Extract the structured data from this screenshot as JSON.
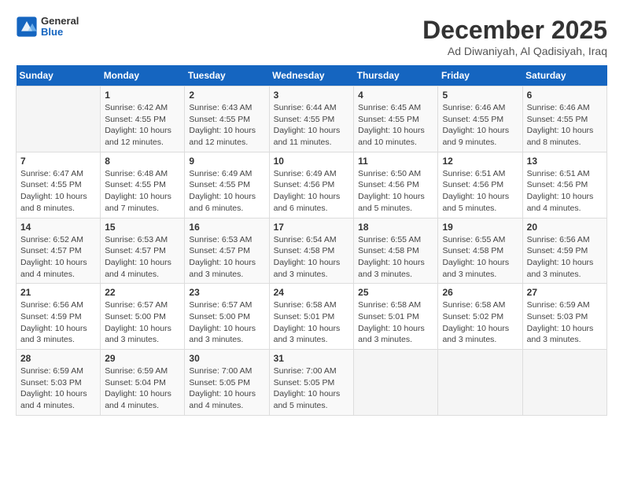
{
  "logo": {
    "text_general": "General",
    "text_blue": "Blue"
  },
  "header": {
    "month": "December 2025",
    "location": "Ad Diwaniyah, Al Qadisiyah, Iraq"
  },
  "weekdays": [
    "Sunday",
    "Monday",
    "Tuesday",
    "Wednesday",
    "Thursday",
    "Friday",
    "Saturday"
  ],
  "weeks": [
    [
      {
        "day": "",
        "info": ""
      },
      {
        "day": "1",
        "info": "Sunrise: 6:42 AM\nSunset: 4:55 PM\nDaylight: 10 hours\nand 12 minutes."
      },
      {
        "day": "2",
        "info": "Sunrise: 6:43 AM\nSunset: 4:55 PM\nDaylight: 10 hours\nand 12 minutes."
      },
      {
        "day": "3",
        "info": "Sunrise: 6:44 AM\nSunset: 4:55 PM\nDaylight: 10 hours\nand 11 minutes."
      },
      {
        "day": "4",
        "info": "Sunrise: 6:45 AM\nSunset: 4:55 PM\nDaylight: 10 hours\nand 10 minutes."
      },
      {
        "day": "5",
        "info": "Sunrise: 6:46 AM\nSunset: 4:55 PM\nDaylight: 10 hours\nand 9 minutes."
      },
      {
        "day": "6",
        "info": "Sunrise: 6:46 AM\nSunset: 4:55 PM\nDaylight: 10 hours\nand 8 minutes."
      }
    ],
    [
      {
        "day": "7",
        "info": "Sunrise: 6:47 AM\nSunset: 4:55 PM\nDaylight: 10 hours\nand 8 minutes."
      },
      {
        "day": "8",
        "info": "Sunrise: 6:48 AM\nSunset: 4:55 PM\nDaylight: 10 hours\nand 7 minutes."
      },
      {
        "day": "9",
        "info": "Sunrise: 6:49 AM\nSunset: 4:55 PM\nDaylight: 10 hours\nand 6 minutes."
      },
      {
        "day": "10",
        "info": "Sunrise: 6:49 AM\nSunset: 4:56 PM\nDaylight: 10 hours\nand 6 minutes."
      },
      {
        "day": "11",
        "info": "Sunrise: 6:50 AM\nSunset: 4:56 PM\nDaylight: 10 hours\nand 5 minutes."
      },
      {
        "day": "12",
        "info": "Sunrise: 6:51 AM\nSunset: 4:56 PM\nDaylight: 10 hours\nand 5 minutes."
      },
      {
        "day": "13",
        "info": "Sunrise: 6:51 AM\nSunset: 4:56 PM\nDaylight: 10 hours\nand 4 minutes."
      }
    ],
    [
      {
        "day": "14",
        "info": "Sunrise: 6:52 AM\nSunset: 4:57 PM\nDaylight: 10 hours\nand 4 minutes."
      },
      {
        "day": "15",
        "info": "Sunrise: 6:53 AM\nSunset: 4:57 PM\nDaylight: 10 hours\nand 4 minutes."
      },
      {
        "day": "16",
        "info": "Sunrise: 6:53 AM\nSunset: 4:57 PM\nDaylight: 10 hours\nand 3 minutes."
      },
      {
        "day": "17",
        "info": "Sunrise: 6:54 AM\nSunset: 4:58 PM\nDaylight: 10 hours\nand 3 minutes."
      },
      {
        "day": "18",
        "info": "Sunrise: 6:55 AM\nSunset: 4:58 PM\nDaylight: 10 hours\nand 3 minutes."
      },
      {
        "day": "19",
        "info": "Sunrise: 6:55 AM\nSunset: 4:58 PM\nDaylight: 10 hours\nand 3 minutes."
      },
      {
        "day": "20",
        "info": "Sunrise: 6:56 AM\nSunset: 4:59 PM\nDaylight: 10 hours\nand 3 minutes."
      }
    ],
    [
      {
        "day": "21",
        "info": "Sunrise: 6:56 AM\nSunset: 4:59 PM\nDaylight: 10 hours\nand 3 minutes."
      },
      {
        "day": "22",
        "info": "Sunrise: 6:57 AM\nSunset: 5:00 PM\nDaylight: 10 hours\nand 3 minutes."
      },
      {
        "day": "23",
        "info": "Sunrise: 6:57 AM\nSunset: 5:00 PM\nDaylight: 10 hours\nand 3 minutes."
      },
      {
        "day": "24",
        "info": "Sunrise: 6:58 AM\nSunset: 5:01 PM\nDaylight: 10 hours\nand 3 minutes."
      },
      {
        "day": "25",
        "info": "Sunrise: 6:58 AM\nSunset: 5:01 PM\nDaylight: 10 hours\nand 3 minutes."
      },
      {
        "day": "26",
        "info": "Sunrise: 6:58 AM\nSunset: 5:02 PM\nDaylight: 10 hours\nand 3 minutes."
      },
      {
        "day": "27",
        "info": "Sunrise: 6:59 AM\nSunset: 5:03 PM\nDaylight: 10 hours\nand 3 minutes."
      }
    ],
    [
      {
        "day": "28",
        "info": "Sunrise: 6:59 AM\nSunset: 5:03 PM\nDaylight: 10 hours\nand 4 minutes."
      },
      {
        "day": "29",
        "info": "Sunrise: 6:59 AM\nSunset: 5:04 PM\nDaylight: 10 hours\nand 4 minutes."
      },
      {
        "day": "30",
        "info": "Sunrise: 7:00 AM\nSunset: 5:05 PM\nDaylight: 10 hours\nand 4 minutes."
      },
      {
        "day": "31",
        "info": "Sunrise: 7:00 AM\nSunset: 5:05 PM\nDaylight: 10 hours\nand 5 minutes."
      },
      {
        "day": "",
        "info": ""
      },
      {
        "day": "",
        "info": ""
      },
      {
        "day": "",
        "info": ""
      }
    ]
  ]
}
